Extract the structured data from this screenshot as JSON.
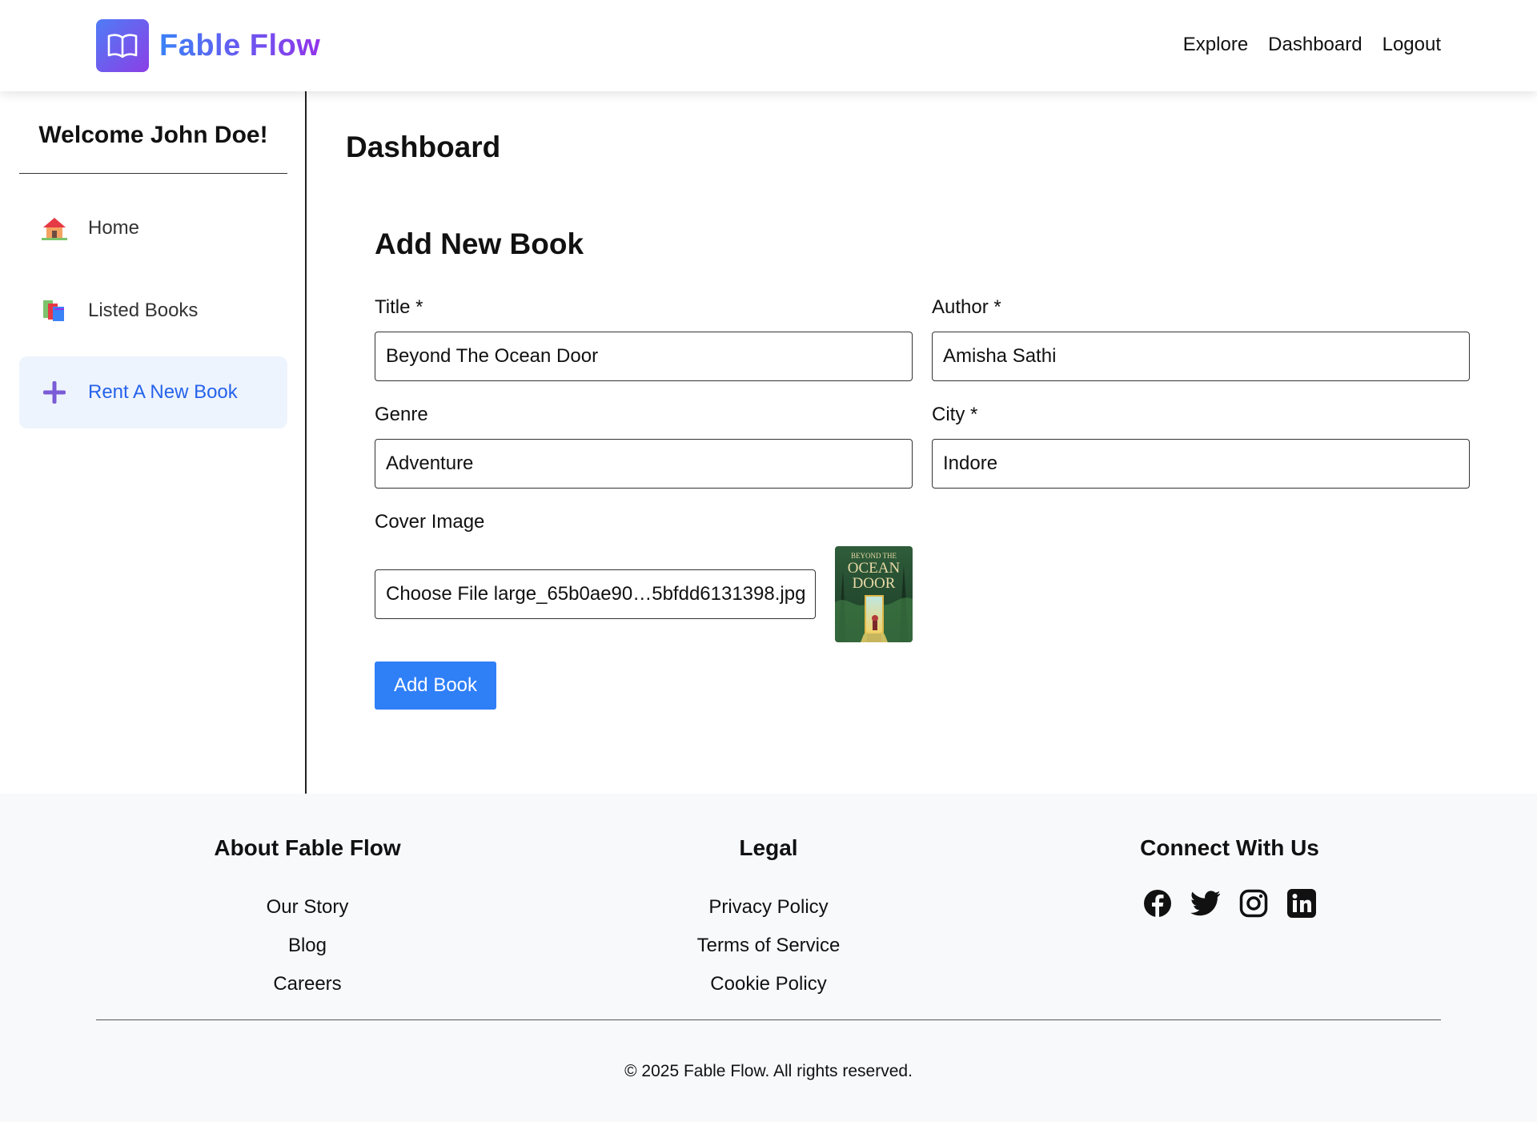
{
  "header": {
    "brand": "Fable Flow",
    "nav": [
      "Explore",
      "Dashboard",
      "Logout"
    ]
  },
  "sidebar": {
    "welcome": "Welcome John Doe!",
    "items": [
      {
        "label": "Home",
        "icon": "house-icon"
      },
      {
        "label": "Listed Books",
        "icon": "books-icon"
      },
      {
        "label": "Rent A New Book",
        "icon": "plus-icon",
        "active": true
      }
    ]
  },
  "main": {
    "page_title": "Dashboard",
    "form_title": "Add New Book",
    "fields": {
      "title": {
        "label": "Title *",
        "value": "Beyond The Ocean Door"
      },
      "author": {
        "label": "Author *",
        "value": "Amisha Sathi"
      },
      "genre": {
        "label": "Genre",
        "value": "Adventure"
      },
      "city": {
        "label": "City *",
        "value": "Indore"
      },
      "cover": {
        "label": "Cover Image",
        "button": "Choose File",
        "filename": "large_65b0ae90…5bfdd6131398.jpg"
      }
    },
    "cover_thumbnail": {
      "title_lines": [
        "BEYOND THE",
        "OCEAN",
        "DOOR"
      ]
    },
    "submit_label": "Add Book"
  },
  "footer": {
    "about": {
      "heading": "About Fable Flow",
      "links": [
        "Our Story",
        "Blog",
        "Careers"
      ]
    },
    "legal": {
      "heading": "Legal",
      "links": [
        "Privacy Policy",
        "Terms of Service",
        "Cookie Policy"
      ]
    },
    "connect": {
      "heading": "Connect With Us",
      "icons": [
        "facebook-icon",
        "twitter-icon",
        "instagram-icon",
        "linkedin-icon"
      ]
    },
    "copyright": "© 2025 Fable Flow. All rights reserved."
  },
  "colors": {
    "accent": "#2f7ff7",
    "brand_gradient_start": "#3b82f6",
    "brand_gradient_end": "#9333ea",
    "active_bg": "#eef4fd",
    "footer_bg": "#f8f9fb"
  }
}
